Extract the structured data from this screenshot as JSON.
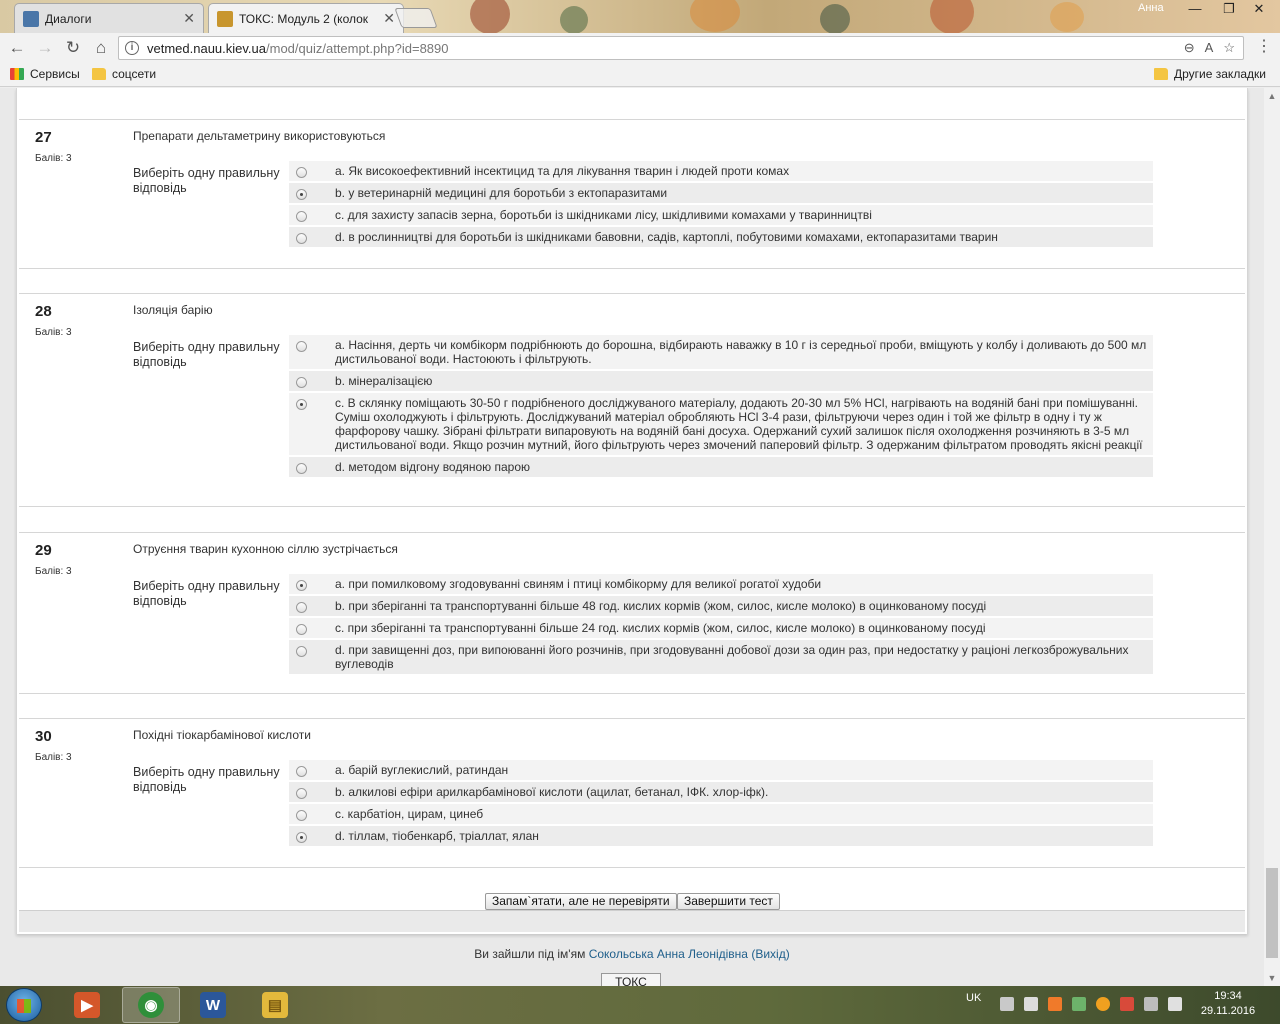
{
  "browser": {
    "tabs": [
      {
        "title": "Диалоги",
        "favicon_color": "#4a76a8",
        "active": false
      },
      {
        "title": "ТОКС: Модуль 2 (колок",
        "favicon_color": "#c8962e",
        "active": true
      }
    ],
    "profile_name": "Анна",
    "window_controls": {
      "minimize": "—",
      "maximize": "❐",
      "close": "✕"
    },
    "nav": {
      "back": "←",
      "forward": "→",
      "reload": "↻",
      "home": "⌂"
    },
    "url": {
      "host": "vetmed.nauu.kiev.ua",
      "path": "/mod/quiz/attempt.php?id=8890"
    },
    "omnibox_icons": {
      "zoom": "⊖",
      "translate": "A",
      "star": "☆"
    },
    "menu_glyph": "⋮",
    "bookmarks": [
      {
        "label": "Сервисы",
        "icon": "apps-icon"
      },
      {
        "label": "соцсети",
        "icon": "folder-icon"
      }
    ],
    "other_bookmarks": "Другие закладки"
  },
  "quiz": {
    "prompt_label": "Виберіть одну правильну відповідь",
    "questions": [
      {
        "number": "27",
        "grade": "Балів: 3",
        "text": "Препарати дельтаметрину використовуються",
        "answers": [
          {
            "label": "a. Як високоефективний інсектицид та для лікування тварин і людей проти комах",
            "selected": false
          },
          {
            "label": "b. у ветеринарній медицині для боротьби з ектопаразитами",
            "selected": true
          },
          {
            "label": "c. для захисту запасів зерна, боротьби із шкідниками лісу, шкідливими комахами у тваринництві",
            "selected": false
          },
          {
            "label": "d. в рослинництві для боротьби із шкідниками бавовни, садів, картоплі, побутовими комахами, ектопаразитами тварин",
            "selected": false
          }
        ]
      },
      {
        "number": "28",
        "grade": "Балів: 3",
        "text": "Ізоляція барію",
        "answers": [
          {
            "label": "a. Насіння, дерть чи комбікорм подрібнюють до борошна, відбирають наважку в 10 г із середньої проби, вміщують у колбу і доливають до 500 мл дистильованої води. Настоюють і фільтрують.",
            "selected": false
          },
          {
            "label": "b. мінералізацією",
            "selected": false
          },
          {
            "label": "c. В склянку поміщають 30-50 г подрібненого досліджуваного матеріалу, додають 20-30 мл 5% HCl, нагрівають на водяній бані при помішуванні. Суміш охолоджують і фільтрують. Досліджуваний матеріал обробляють HCl 3-4 рази, фільтруючи через один і той же фільтр в одну і ту ж фарфорову чашку. Зібрані фільтрати випаровують на водяній бані досуха. Одержаний сухий залишок після охолодження розчиняють в 3-5 мл дистильованої води. Якщо розчин мутний, його фільтрують через змочений паперовий фільтр. З одержаним фільтратом проводять якісні реакції",
            "selected": true
          },
          {
            "label": "d. методом відгону водяною парою",
            "selected": false
          }
        ]
      },
      {
        "number": "29",
        "grade": "Балів: 3",
        "text": "Отруєння тварин кухонною сіллю зустрічається",
        "answers": [
          {
            "label": "a. при помилковому згодовуванні свиням і птиці комбікорму для великої рогатої худоби",
            "selected": true
          },
          {
            "label": "b. при зберіганні та транспортуванні більше 48 год. кислих кормів (жом, силос, кисле молоко) в оцинкованому посуді",
            "selected": false
          },
          {
            "label": "c. при зберіганні та транспортуванні більше 24 год. кислих кормів (жом, силос, кисле молоко) в оцинкованому посуді",
            "selected": false
          },
          {
            "label": "d. при завищенні доз, при випоюванні його розчинів, при згодовуванні добової дози за один раз, при недостатку у раціоні легкозброжувальних вуглеводів",
            "selected": false
          }
        ]
      },
      {
        "number": "30",
        "grade": "Балів: 3",
        "text": "Похідні тіокарбамінової кислоти",
        "answers": [
          {
            "label": "a. барій вуглекислий, ратиндан",
            "selected": false
          },
          {
            "label": "b. алкилові ефіри арилкарбамінової кислоти (ацилат, бетанал, ІФК. хлор-іфк).",
            "selected": false
          },
          {
            "label": "c. карбатіон, цирам, цинеб",
            "selected": false
          },
          {
            "label": "d. тіллам, тіобенкарб, тріаллат, ялан",
            "selected": true
          }
        ]
      }
    ],
    "buttons": {
      "save_without_submit": "Запам`ятати, але не перевіряти",
      "finish": "Завершити тест"
    }
  },
  "login": {
    "prefix": "Ви зайшли під ім'ям",
    "user": "Сокольська Анна Леонідівна",
    "logout": "(Вихід)"
  },
  "course_link": "ТОКС",
  "taskbar": {
    "apps": [
      {
        "name": "media-player",
        "glyph": "▶",
        "color": "#d4572a"
      },
      {
        "name": "chrome",
        "glyph": "◉",
        "color": "#2f8f3a"
      },
      {
        "name": "word",
        "glyph": "W",
        "color": "#2b579a"
      },
      {
        "name": "explorer",
        "glyph": "▤",
        "color": "#e3b93c"
      }
    ],
    "language": "UK",
    "time": "19:34",
    "date": "29.11.2016"
  }
}
